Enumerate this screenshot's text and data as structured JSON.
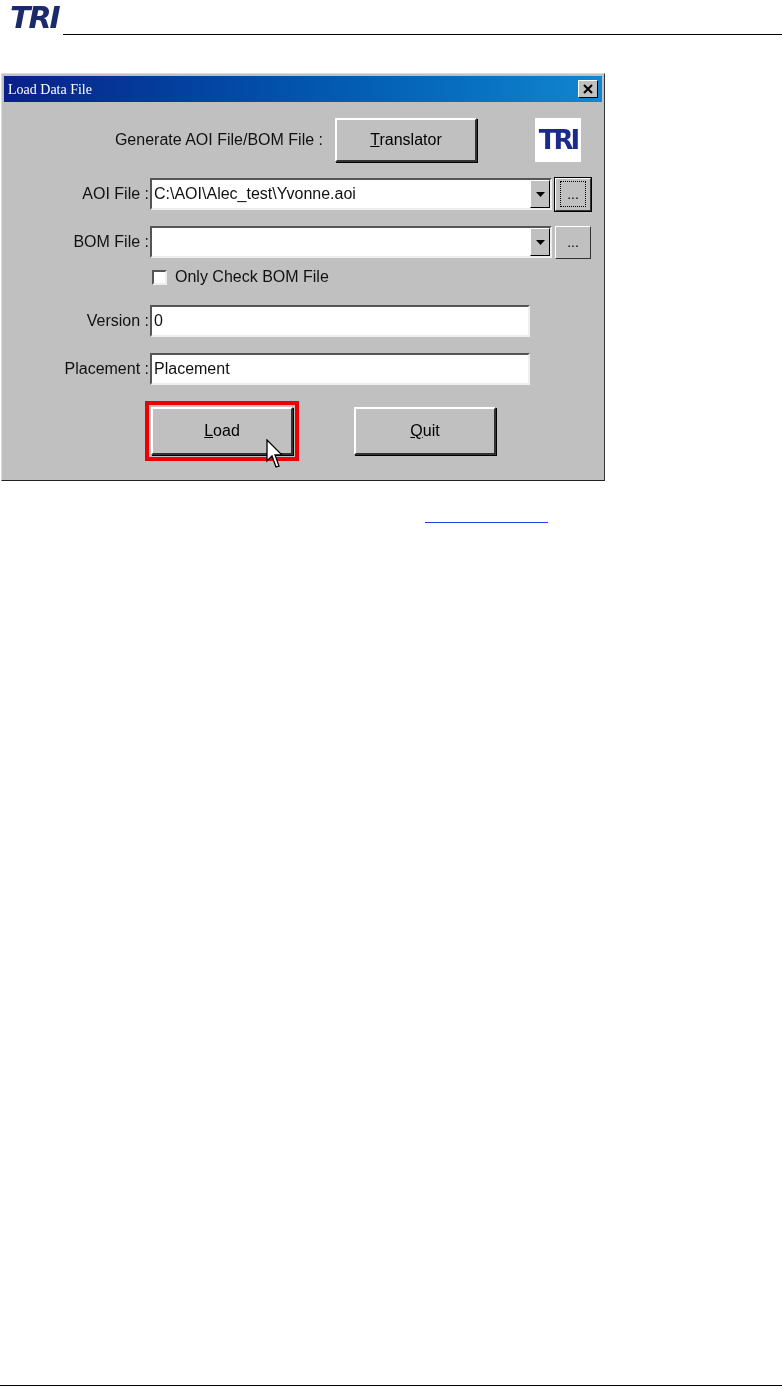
{
  "header": {
    "logo": "TRI"
  },
  "dialog": {
    "title": "Load Data File",
    "generate": {
      "label": "Generate AOI File/BOM File :",
      "button": {
        "label": "Translator",
        "access_key": true
      }
    },
    "logo": "TRI",
    "fields": [
      {
        "kind": "combo",
        "label": "AOI File :",
        "value": "C:\\AOI\\Alec_test\\Yvonne.aoi",
        "browse": "...",
        "browse_focused": true
      },
      {
        "kind": "combo",
        "label": "BOM File :",
        "browse": "...",
        "browse_focused": false
      },
      {
        "kind": "checkbox",
        "label": "Only Check BOM File",
        "checked": false
      },
      {
        "kind": "text",
        "label": "Version :",
        "value": "0"
      },
      {
        "kind": "text",
        "label": "Placement :",
        "value": "Placement"
      }
    ],
    "buttons": [
      {
        "label": "Load",
        "access_key": true,
        "highlighted": true,
        "pointer": true
      },
      {
        "label": "Quit",
        "access_key": true,
        "highlighted": false,
        "pointer": false
      }
    ]
  }
}
